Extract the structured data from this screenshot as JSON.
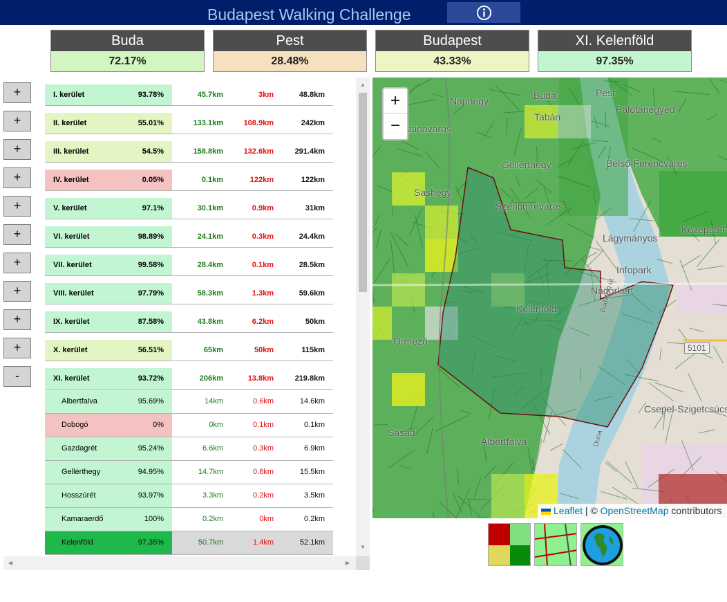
{
  "header": {
    "title": "Budapest Walking Challenge",
    "info_icon": "info-circle-icon"
  },
  "cards": [
    {
      "name": "Buda",
      "value": "72.17%",
      "color": "#d2f5c2"
    },
    {
      "name": "Pest",
      "value": "28.48%",
      "color": "#f5e0c0"
    },
    {
      "name": "Budapest",
      "value": "43.33%",
      "color": "#eef5c2"
    },
    {
      "name": "XI. Kelenföld",
      "value": "97.35%",
      "color": "#c2f5d0"
    }
  ],
  "districts": [
    {
      "name": "I. kerület",
      "pct": "93.78%",
      "walked": "45.7km",
      "remaining": "3km",
      "total": "48.8km",
      "button": "+",
      "color": "#c2f5d2"
    },
    {
      "name": "II. kerület",
      "pct": "55.01%",
      "walked": "133.1km",
      "remaining": "108.9km",
      "total": "242km",
      "button": "+",
      "color": "#e3f5c2"
    },
    {
      "name": "III. kerület",
      "pct": "54.5%",
      "walked": "158.8km",
      "remaining": "132.6km",
      "total": "291.4km",
      "button": "+",
      "color": "#e3f5c2"
    },
    {
      "name": "IV. kerület",
      "pct": "0.05%",
      "walked": "0.1km",
      "remaining": "122km",
      "total": "122km",
      "button": "+",
      "color": "#f5c2c2"
    },
    {
      "name": "V. kerület",
      "pct": "97.1%",
      "walked": "30.1km",
      "remaining": "0.9km",
      "total": "31km",
      "button": "+",
      "color": "#c2f5d2"
    },
    {
      "name": "VI. kerület",
      "pct": "98.89%",
      "walked": "24.1km",
      "remaining": "0.3km",
      "total": "24.4km",
      "button": "+",
      "color": "#c2f5d2"
    },
    {
      "name": "VII. kerület",
      "pct": "99.58%",
      "walked": "28.4km",
      "remaining": "0.1km",
      "total": "28.5km",
      "button": "+",
      "color": "#c2f5d2"
    },
    {
      "name": "VIII. kerület",
      "pct": "97.79%",
      "walked": "58.3km",
      "remaining": "1.3km",
      "total": "59.6km",
      "button": "+",
      "color": "#c2f5d2"
    },
    {
      "name": "IX. kerület",
      "pct": "87.58%",
      "walked": "43.8km",
      "remaining": "6.2km",
      "total": "50km",
      "button": "+",
      "color": "#c2f5d2"
    },
    {
      "name": "X. kerület",
      "pct": "56.51%",
      "walked": "65km",
      "remaining": "50km",
      "total": "115km",
      "button": "+",
      "color": "#e3f5c2"
    },
    {
      "name": "XI. kerület",
      "pct": "93.72%",
      "walked": "206km",
      "remaining": "13.8km",
      "total": "219.8km",
      "button": "-",
      "color": "#c2f5d2"
    }
  ],
  "subdistricts": [
    {
      "name": "Albertfalva",
      "pct": "95.69%",
      "walked": "14km",
      "remaining": "0.6km",
      "total": "14.6km",
      "color": "#c2f5d2"
    },
    {
      "name": "Dobogó",
      "pct": "0%",
      "walked": "0km",
      "remaining": "0.1km",
      "total": "0.1km",
      "color": "#f5c2c2"
    },
    {
      "name": "Gazdagrét",
      "pct": "95.24%",
      "walked": "6.6km",
      "remaining": "0.3km",
      "total": "6.9km",
      "color": "#c2f5d2"
    },
    {
      "name": "Gellérthegy",
      "pct": "94.95%",
      "walked": "14.7km",
      "remaining": "0.8km",
      "total": "15.5km",
      "color": "#c2f5d2"
    },
    {
      "name": "Hosszúrét",
      "pct": "93.97%",
      "walked": "3.3km",
      "remaining": "0.2km",
      "total": "3.5km",
      "color": "#c2f5d2"
    },
    {
      "name": "Kamaraerdő",
      "pct": "100%",
      "walked": "0.2km",
      "remaining": "0km",
      "total": "0.2km",
      "color": "#c2f5d2"
    },
    {
      "name": "Kelenföld",
      "pct": "97.35%",
      "walked": "50.7km",
      "remaining": "1.4km",
      "total": "52.1km",
      "color": "#1fb84a",
      "selected": true
    }
  ],
  "map": {
    "zoom_in": "+",
    "zoom_out": "−",
    "labels": [
      "Naphegy",
      "Buda",
      "Pest",
      "Tabán",
      "Palotanegyed",
      "Krisztinaváros",
      "Gellérthegy",
      "Belső-Ferencváros",
      "Sashegy",
      "Szentimreváros",
      "Középső-Ferencváros",
      "Lágymányos",
      "Infopark",
      "Nádorkert",
      "Kelenföld",
      "Örmező",
      "Albertfalva",
      "Csepel-Szigetcsúcs",
      "Sasad",
      "5101",
      "Duna",
      "Budafoki út"
    ],
    "attribution": {
      "leaflet": "Leaflet",
      "separator": " | © ",
      "osm": "OpenStreetMap",
      "suffix": " contributors"
    }
  },
  "layer_buttons": [
    "coverage-grid-icon",
    "street-lines-icon",
    "globe-icon"
  ]
}
